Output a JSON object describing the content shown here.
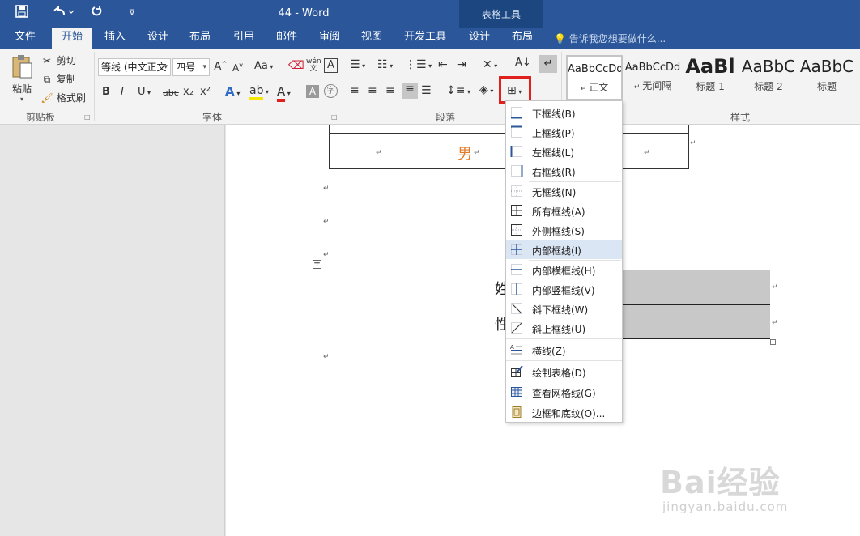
{
  "titlebar": {
    "title": "44 - Word",
    "context_group": "表格工具",
    "save_icon": "save-icon",
    "undo_icon": "undo-icon",
    "redo_icon": "redo-icon",
    "customize_icon": "customize-qat-icon"
  },
  "tabs": [
    {
      "label": "文件"
    },
    {
      "label": "开始"
    },
    {
      "label": "插入"
    },
    {
      "label": "设计"
    },
    {
      "label": "布局"
    },
    {
      "label": "引用"
    },
    {
      "label": "邮件"
    },
    {
      "label": "审阅"
    },
    {
      "label": "视图"
    },
    {
      "label": "开发工具"
    },
    {
      "label": "设计"
    },
    {
      "label": "布局"
    }
  ],
  "tell_me": "告诉我您想要做什么...",
  "clipboard": {
    "paste": "粘贴",
    "cut": "剪切",
    "copy": "复制",
    "format_painter": "格式刷",
    "group": "剪贴板"
  },
  "font": {
    "name": "等线 (中文正文",
    "size": "四号",
    "group": "字体",
    "bold": "B",
    "italic": "I",
    "underline": "U",
    "strike": "abc",
    "sub": "x₂",
    "sup": "x²",
    "grow": "A",
    "shrink": "A",
    "case": "Aa",
    "phonetic": "wén",
    "char_border": "A",
    "char_shade": "A",
    "enclose": "字"
  },
  "paragraph": {
    "group": "段落"
  },
  "styles": {
    "group": "样式",
    "items": [
      {
        "preview": "AaBbCcDd",
        "name": "正文"
      },
      {
        "preview": "AaBbCcDd",
        "name": "无间隔"
      },
      {
        "preview": "AaBl",
        "name": "标题 1"
      },
      {
        "preview": "AaBbC",
        "name": "标题 2"
      },
      {
        "preview": "AaBbC",
        "name": "标题"
      }
    ]
  },
  "document": {
    "cell_male": "男",
    "char_name": "姓",
    "char_sex": "性",
    "return_mark": "↵"
  },
  "border_menu": {
    "items": [
      {
        "label": "下框线(B)",
        "icon": "bottom-border-icon"
      },
      {
        "label": "上框线(P)",
        "icon": "top-border-icon"
      },
      {
        "label": "左框线(L)",
        "icon": "left-border-icon"
      },
      {
        "label": "右框线(R)",
        "icon": "right-border-icon"
      },
      {
        "label": "无框线(N)",
        "icon": "no-border-icon"
      },
      {
        "label": "所有框线(A)",
        "icon": "all-borders-icon"
      },
      {
        "label": "外侧框线(S)",
        "icon": "outside-borders-icon"
      },
      {
        "label": "内部框线(I)",
        "icon": "inside-borders-icon"
      },
      {
        "label": "内部横框线(H)",
        "icon": "inside-horizontal-border-icon"
      },
      {
        "label": "内部竖框线(V)",
        "icon": "inside-vertical-border-icon"
      },
      {
        "label": "斜下框线(W)",
        "icon": "diagonal-down-border-icon"
      },
      {
        "label": "斜上框线(U)",
        "icon": "diagonal-up-border-icon"
      },
      {
        "label": "横线(Z)",
        "icon": "horizontal-line-icon"
      },
      {
        "label": "绘制表格(D)",
        "icon": "draw-table-icon"
      },
      {
        "label": "查看网格线(G)",
        "icon": "view-gridlines-icon"
      },
      {
        "label": "边框和底纹(O)...",
        "icon": "borders-shading-icon"
      }
    ]
  },
  "watermark": {
    "brand": "Bai经验",
    "url": "jingyan.baidu.com"
  },
  "colors": {
    "title_blue": "#2b579a",
    "highlight_red": "#e0201c",
    "cell_text_orange": "#e07b2c"
  }
}
